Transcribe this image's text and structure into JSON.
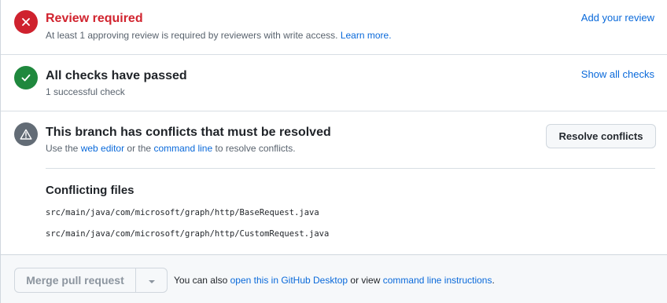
{
  "review": {
    "title": "Review required",
    "description": "At least 1 approving review is required by reviewers with write access.",
    "learn_more": "Learn more.",
    "action": "Add your review"
  },
  "checks": {
    "title": "All checks have passed",
    "description": "1 successful check",
    "action": "Show all checks"
  },
  "conflicts": {
    "title": "This branch has conflicts that must be resolved",
    "desc_prefix": "Use the",
    "web_editor": "web editor",
    "desc_or": "or the",
    "command_line": "command line",
    "desc_suffix": "to resolve conflicts.",
    "resolve_button": "Resolve conflicts",
    "files_heading": "Conflicting files",
    "files": [
      "src/main/java/com/microsoft/graph/http/BaseRequest.java",
      "src/main/java/com/microsoft/graph/http/CustomRequest.java"
    ]
  },
  "merge": {
    "button": "Merge pull request",
    "note_prefix": "You can also",
    "open_desktop": "open this in GitHub Desktop",
    "note_middle": "or view",
    "cli_instructions": "command line instructions",
    "note_suffix": "."
  },
  "colors": {
    "error": "#cf222e",
    "success": "#1f883d",
    "neutral": "#636c76",
    "link": "#0969da"
  },
  "icons": {
    "review": "x-circle-icon",
    "checks": "check-circle-icon",
    "conflicts": "alert-icon",
    "merge_dropdown": "triangle-down-icon"
  }
}
